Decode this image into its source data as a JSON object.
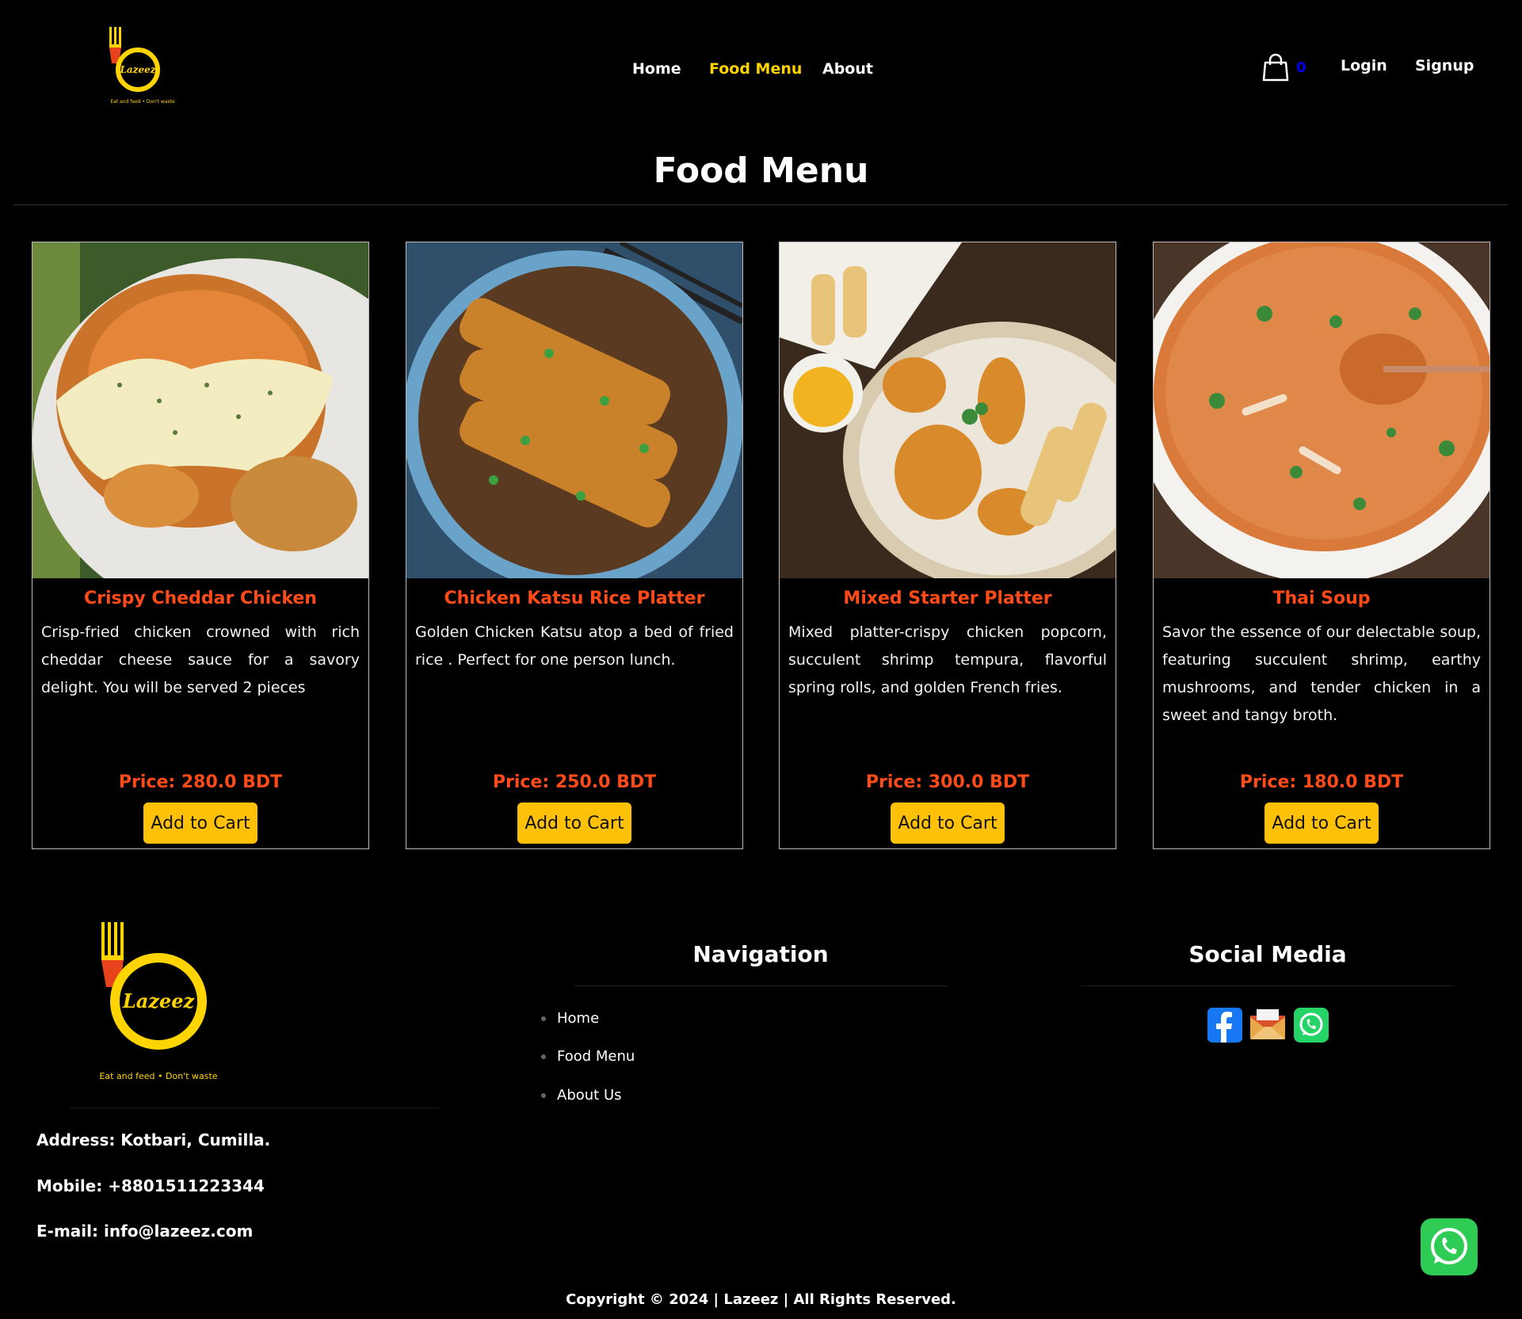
{
  "brand": {
    "logo_text": "Lazeez",
    "tagline_small": "Eat and feed  •  Don't waste",
    "tagline": "Eat and feed  •  Don't waste",
    "accent_color": "#ffd400",
    "price_color": "#ff4a1a",
    "button_color": "#ffc107"
  },
  "nav": {
    "home": "Home",
    "food_menu": "Food Menu",
    "about": "About",
    "active": "food_menu"
  },
  "cart": {
    "icon": "shopping-bag-icon",
    "count": "0"
  },
  "auth": {
    "login": "Login",
    "signup": "Signup"
  },
  "page": {
    "title": "Food Menu"
  },
  "menu": {
    "items": [
      {
        "name": "Crispy Cheddar Chicken",
        "description": "Crisp-fried chicken crowned with rich cheddar cheese sauce for a savory delight. You will be served 2 pieces",
        "price": "Price: 280.0 BDT",
        "button": "Add to Cart"
      },
      {
        "name": "Chicken Katsu Rice Platter",
        "description": "Golden Chicken Katsu atop a bed of fried rice . Perfect for one person lunch.",
        "price": "Price: 250.0 BDT",
        "button": "Add to Cart"
      },
      {
        "name": "Mixed Starter Platter",
        "description": "Mixed platter-crispy chicken popcorn, succulent shrimp tempura, flavorful spring rolls, and golden French fries.",
        "price": "Price: 300.0 BDT",
        "button": "Add to Cart"
      },
      {
        "name": "Thai Soup",
        "description": "Savor the essence of our delectable soup, featuring succulent shrimp, earthy mushrooms, and tender chicken in a sweet and tangy broth.",
        "price": "Price: 180.0 BDT",
        "button": "Add to Cart"
      }
    ]
  },
  "footer": {
    "contact": {
      "address": "Address: Kotbari, Cumilla.",
      "mobile": "Mobile: +8801511223344",
      "email": "E-mail: info@lazeez.com"
    },
    "navigation": {
      "heading": "Navigation",
      "links": [
        "Home",
        "Food Menu",
        "About Us"
      ]
    },
    "social": {
      "heading": "Social Media",
      "icons": [
        "facebook-icon",
        "email-icon",
        "whatsapp-icon"
      ]
    },
    "copyright": "Copyright © 2024 | Lazeez | All Rights Reserved."
  }
}
